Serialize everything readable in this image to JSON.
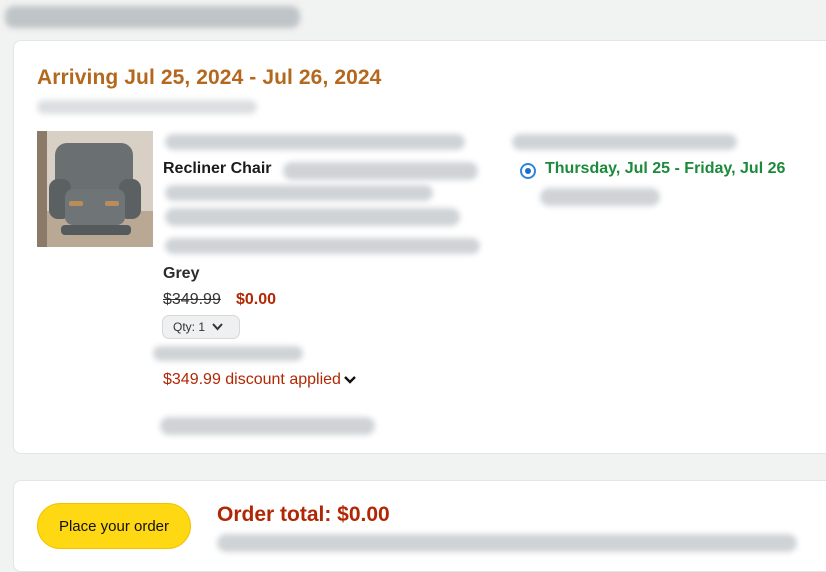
{
  "delivery": {
    "arriving": "Arriving Jul 25, 2024 - Jul 26, 2024",
    "selected_option": "Thursday, Jul 25 - Friday, Jul 26"
  },
  "item": {
    "name": "Recliner Chair",
    "color": "Grey",
    "price_original": "$349.99",
    "price_current": "$0.00",
    "qty_label": "Qty: 1",
    "discount_text": "$349.99 discount applied"
  },
  "order": {
    "place_button": "Place your order",
    "total": "Order total: $0.00"
  }
}
